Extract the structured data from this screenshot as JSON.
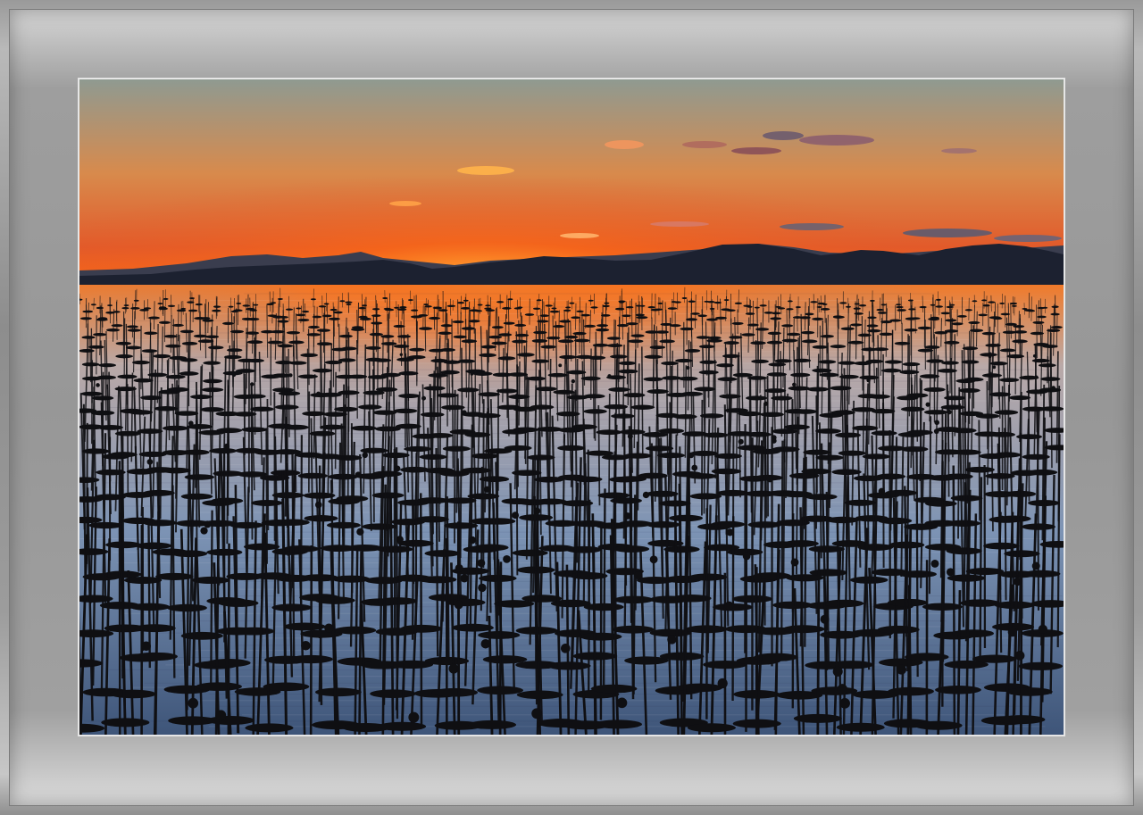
{
  "scene": {
    "subject": "sunset-over-seaweed-farm",
    "colors": {
      "sky_top": "#8f9a91",
      "sky_mid": "#d88a4c",
      "sky_glow": "#ff6a12",
      "sky_low": "#e25a2a",
      "sun_core": "#ffb23a",
      "mountains_far": "#3a3d4e",
      "mountains_near": "#1c2130",
      "water_reflect": "#f07a2a",
      "water_mid": "#b9a9a8",
      "water_blue": "#7c93b4",
      "water_deep": "#3e5579",
      "stakes": "#0f0f12",
      "mat": "#9e9e9e"
    }
  }
}
